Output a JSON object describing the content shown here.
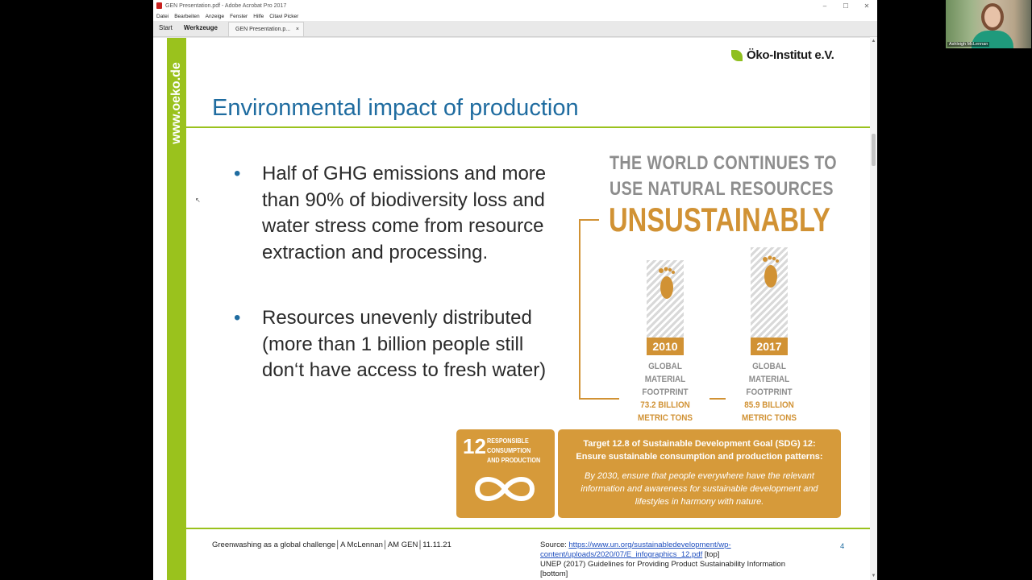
{
  "window": {
    "title": "GEN Presentation.pdf - Adobe Acrobat Pro 2017",
    "controls": [
      "–",
      "☐",
      "✕"
    ]
  },
  "menu": [
    "Datei",
    "Bearbeiten",
    "Anzeige",
    "Fenster",
    "Hilfe",
    "Citavi Picker"
  ],
  "tabs": {
    "start": "Start",
    "tools": "Werkzeuge",
    "document": "GEN Presentation.p...",
    "close": "×"
  },
  "slide": {
    "side_url": "www.oeko.de",
    "logo_text": "Öko-Institut e.V.",
    "title": "Environmental impact of production",
    "bullets": [
      {
        "dot": "•",
        "text": "Half of GHG emissions and more than 90% of biodiversity loss and water stress come from resource extraction and processing."
      },
      {
        "dot": "•",
        "text": "Resources unevenly distributed (more than 1 billion people still don‘t have access to fresh water)"
      }
    ],
    "infographic": {
      "line1": "THE WORLD CONTINUES TO",
      "line2": "USE NATURAL RESOURCES",
      "line3": "UNSUSTAINABLY",
      "left": {
        "year": "2010",
        "label1": "GLOBAL MATERIAL",
        "label2": "FOOTPRINT",
        "value1": "73.2 BILLION",
        "value2": "METRIC TONS"
      },
      "right": {
        "year": "2017",
        "label1": "GLOBAL MATERIAL",
        "label2": "FOOTPRINT",
        "value1": "85.9 BILLION",
        "value2": "METRIC TONS"
      }
    },
    "sdg": {
      "number": "12",
      "label": "RESPONSIBLE CONSUMPTION AND PRODUCTION"
    },
    "target": {
      "heading1": "Target 12.8 of Sustainable Development Goal (SDG) 12:",
      "heading2": "Ensure sustainable consumption and production patterns:",
      "body": "By 2030, ensure that people everywhere have the relevant information and awareness for sustainable development and lifestyles in harmony with nature."
    },
    "footer_left": "Greenwashing as a global challenge│A McLennan│AM GEN│11.11.21",
    "source_prefix": "Source: ",
    "source_link": "https://www.un.org/sustainabledevelopment/wp-content/uploads/2020/07/E_infographics_12.pdf",
    "source_top": " [top]",
    "source_second": "UNEP (2017) Guidelines for Providing Product Sustainability Information [bottom]",
    "page_number": "4"
  },
  "webcam": {
    "name": "Ashleigh McLennan"
  },
  "colors": {
    "green": "#9ac21d",
    "title_blue": "#1f6ca0",
    "orange": "#d19234",
    "gray": "#8d8d8d"
  }
}
